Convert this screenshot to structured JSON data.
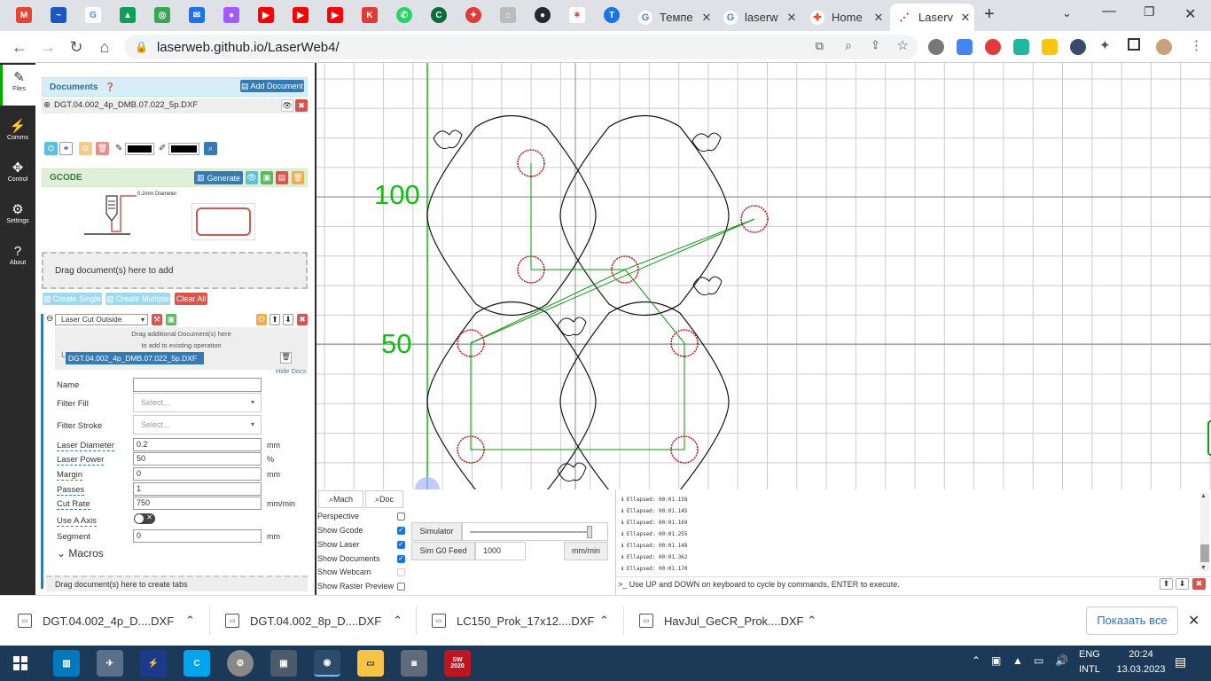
{
  "browser": {
    "tabs": [
      {
        "label": "Темпе"
      },
      {
        "label": "laserw"
      },
      {
        "label": "Home"
      },
      {
        "label": "Laserv"
      }
    ],
    "url": "laserweb.github.io/LaserWeb4/"
  },
  "nav": {
    "files": "Files",
    "comms": "Comms",
    "control": "Control",
    "settings": "Settings",
    "about": "About"
  },
  "documents": {
    "title": "Documents",
    "add_button": "Add Document",
    "file": "DGT.04.002_4p_DMB.07.022_5p.DXF"
  },
  "gcode": {
    "title": "GCODE",
    "generate_button": "Generate",
    "diameter_note": "0.2mm Diameter",
    "drop_zone": "Drag document(s) here to add",
    "create_single": "Create Single",
    "create_multiple": "Create Multiple",
    "clear_all": "Clear All"
  },
  "operation": {
    "type": "Laser Cut Outside",
    "drag_hint_1": "Drag additional Document(s) here",
    "drag_hint_2": "to add to existing operation",
    "doc": "DGT.04.002_4p_DMB.07.022_5p.DXF",
    "hide_docs": "Hide Docs",
    "name_label": "Name",
    "name_value": "",
    "filter_fill_label": "Filter Fill",
    "filter_fill_placeholder": "Select...",
    "filter_stroke_label": "Filter Stroke",
    "filter_stroke_placeholder": "Select...",
    "laser_diameter_label": "Laser Diameter",
    "laser_diameter": "0.2",
    "laser_diameter_unit": "mm",
    "laser_power_label": "Laser Power",
    "laser_power": "50",
    "laser_power_unit": "%",
    "margin_label": "Margin",
    "margin": "0",
    "margin_unit": "mm",
    "passes_label": "Passes",
    "passes": "1",
    "cut_rate_label": "Cut Rate",
    "cut_rate": "750",
    "cut_rate_unit": "mm/min",
    "use_a_axis_label": "Use A Axis",
    "segment_label": "Segment",
    "segment": "0",
    "segment_unit": "mm",
    "macros": "Macros",
    "tabs_drop": "Drag document(s) here to create tabs"
  },
  "canvas": {
    "label_100": "100",
    "label_50": "50"
  },
  "view_controls": {
    "mach": "Mach",
    "doc": "Doc",
    "perspective": "Perspective",
    "show_gcode": "Show Gcode",
    "show_laser": "Show Laser",
    "show_documents": "Show Documents",
    "show_webcam": "Show Webcam",
    "show_raster_preview": "Show Raster Preview",
    "simulator": "Simulator",
    "sim_g0_feed": "Sim G0 Feed",
    "sim_g0_value": "1000",
    "sim_unit": "mm/min"
  },
  "console": {
    "lines": [
      "ℹ Ellapsed: 00:01.158",
      "ℹ Ellapsed: 00:01.145",
      "ℹ Ellapsed: 00:01.169",
      "ℹ Ellapsed: 00:01.255",
      "ℹ Ellapsed: 00:01.148",
      "ℹ Ellapsed: 00:01.362",
      "ℹ Ellapsed: 00:01.170"
    ],
    "prompt": ">_ Use UP and DOWN on keyboard to cycle by commands, ENTER to execute."
  },
  "downloads": {
    "items": [
      "DGT.04.002_4p_D....DXF",
      "DGT.04.002_8p_D....DXF",
      "LC150_Prok_17x12....DXF",
      "HavJul_GeCR_Prok....DXF"
    ],
    "show_all": "Показать все"
  },
  "taskbar": {
    "lang_1": "ENG",
    "lang_2": "INTL",
    "time": "20:24",
    "date": "13.03.2023",
    "sw_badge": "2020"
  },
  "colors": {
    "accent": "#337ab7",
    "green_path": "#0a9a0a",
    "red_circle": "#c0141e"
  }
}
